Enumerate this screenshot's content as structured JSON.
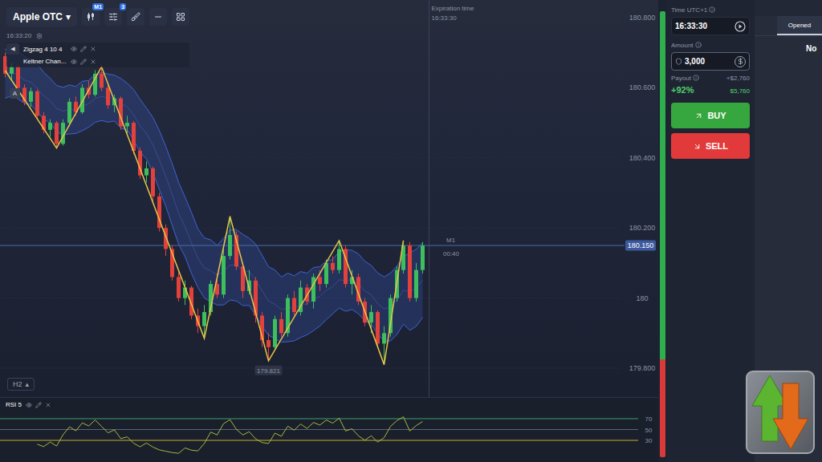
{
  "toolbar": {
    "asset": "Apple OTC",
    "asset_caret": "▾",
    "timeframe_badge": "M1",
    "indicators_badge": "3"
  },
  "chart_clock": "16:33:20",
  "collapse_glyph": "◀",
  "indicators": [
    {
      "label": "Zigzag 4 10 4"
    },
    {
      "label": "Keltner Chan..."
    }
  ],
  "drawing_marker": "A",
  "expiration": {
    "label": "Expiration time",
    "time": "16:33:30",
    "index": 66
  },
  "price_axis": {
    "ticks": [
      {
        "label": "180.800",
        "value": 180.8
      },
      {
        "label": "180.600",
        "value": 180.6
      },
      {
        "label": "180.400",
        "value": 180.4
      },
      {
        "label": "180.200",
        "value": 180.2
      },
      {
        "label": "180",
        "value": 180.0
      },
      {
        "label": "179.800",
        "value": 179.8
      }
    ]
  },
  "current_price": {
    "label": "180.150",
    "value": 180.15,
    "timeframe": "M1",
    "countdown": "00:40"
  },
  "low_label": {
    "label": "179.821",
    "value": 179.821,
    "index": 41
  },
  "candles": [
    [
      180.69,
      180.7,
      180.63,
      180.64
    ],
    [
      180.64,
      180.67,
      180.62,
      180.66
    ],
    [
      180.66,
      180.665,
      180.59,
      180.6
    ],
    [
      180.6,
      180.61,
      180.55,
      180.56
    ],
    [
      180.56,
      180.6,
      180.545,
      180.59
    ],
    [
      180.59,
      180.595,
      180.51,
      180.52
    ],
    [
      180.52,
      180.53,
      180.47,
      180.48
    ],
    [
      180.48,
      180.51,
      180.46,
      180.5
    ],
    [
      180.5,
      180.505,
      180.428,
      180.44
    ],
    [
      180.44,
      180.51,
      180.435,
      180.5
    ],
    [
      180.5,
      180.57,
      180.49,
      180.56
    ],
    [
      180.56,
      180.575,
      180.52,
      180.53
    ],
    [
      180.53,
      180.61,
      180.525,
      180.6
    ],
    [
      180.6,
      180.62,
      180.57,
      180.58
    ],
    [
      180.58,
      180.65,
      180.575,
      180.64
    ],
    [
      180.64,
      180.66,
      180.59,
      180.6
    ],
    [
      180.6,
      180.61,
      180.54,
      180.55
    ],
    [
      180.55,
      180.58,
      180.53,
      180.57
    ],
    [
      180.57,
      180.575,
      180.48,
      180.49
    ],
    [
      180.49,
      180.52,
      180.47,
      180.5
    ],
    [
      180.5,
      180.505,
      180.41,
      180.42
    ],
    [
      180.42,
      180.43,
      180.34,
      180.35
    ],
    [
      180.35,
      180.39,
      180.33,
      180.37
    ],
    [
      180.37,
      180.375,
      180.27,
      180.29
    ],
    [
      180.29,
      180.3,
      180.19,
      180.2
    ],
    [
      180.2,
      180.21,
      180.12,
      180.14
    ],
    [
      180.14,
      180.15,
      180.05,
      180.06
    ],
    [
      180.06,
      180.08,
      179.99,
      180.0
    ],
    [
      180.0,
      180.05,
      179.98,
      180.03
    ],
    [
      180.03,
      180.035,
      179.94,
      179.95
    ],
    [
      179.95,
      179.97,
      179.9,
      179.92
    ],
    [
      179.92,
      179.98,
      179.885,
      179.96
    ],
    [
      179.96,
      180.05,
      179.95,
      180.04
    ],
    [
      180.04,
      180.07,
      180.0,
      180.01
    ],
    [
      180.01,
      180.14,
      180.0,
      180.12
    ],
    [
      180.12,
      180.233,
      180.11,
      180.18
    ],
    [
      180.18,
      180.19,
      180.08,
      180.09
    ],
    [
      180.09,
      180.1,
      180.0,
      180.02
    ],
    [
      180.02,
      180.08,
      180.01,
      180.05
    ],
    [
      180.05,
      180.06,
      179.93,
      179.95
    ],
    [
      179.95,
      179.96,
      179.86,
      179.88
    ],
    [
      179.88,
      179.9,
      179.821,
      179.86
    ],
    [
      179.86,
      179.95,
      179.85,
      179.94
    ],
    [
      179.94,
      179.96,
      179.89,
      179.9
    ],
    [
      179.9,
      180.01,
      179.89,
      180.0
    ],
    [
      180.0,
      180.02,
      179.95,
      179.96
    ],
    [
      179.96,
      180.05,
      179.95,
      180.03
    ],
    [
      180.03,
      180.04,
      179.98,
      179.99
    ],
    [
      179.99,
      180.07,
      179.97,
      180.06
    ],
    [
      180.06,
      180.08,
      180.02,
      180.04
    ],
    [
      180.04,
      180.11,
      180.03,
      180.1
    ],
    [
      180.1,
      180.12,
      180.07,
      180.08
    ],
    [
      180.08,
      180.164,
      180.07,
      180.14
    ],
    [
      180.14,
      180.15,
      180.03,
      180.04
    ],
    [
      180.04,
      180.08,
      180.01,
      180.06
    ],
    [
      180.06,
      180.07,
      179.98,
      179.99
    ],
    [
      179.99,
      180.0,
      179.92,
      179.93
    ],
    [
      179.93,
      179.98,
      179.9,
      179.96
    ],
    [
      179.96,
      179.965,
      179.86,
      179.87
    ],
    [
      179.87,
      179.92,
      179.81,
      179.9
    ],
    [
      179.9,
      180.01,
      179.89,
      180.0
    ],
    [
      180.0,
      180.09,
      179.99,
      180.08
    ],
    [
      180.08,
      180.164,
      180.07,
      180.15
    ],
    [
      180.15,
      180.16,
      179.99,
      180.0
    ],
    [
      180.0,
      180.1,
      179.99,
      180.08
    ],
    [
      180.08,
      180.16,
      180.07,
      180.15
    ]
  ],
  "zigzag": [
    [
      0,
      180.649
    ],
    [
      8,
      180.428
    ],
    [
      15,
      180.66
    ],
    [
      31,
      179.885
    ],
    [
      35,
      180.233
    ],
    [
      41,
      179.821
    ],
    [
      52,
      180.164
    ],
    [
      59,
      179.81
    ],
    [
      62,
      180.164
    ]
  ],
  "period_badge": {
    "label": "H2",
    "caret": "▴"
  },
  "rsi": {
    "label": "RSI 5",
    "levels": [
      {
        "label": "70",
        "value": 70
      },
      {
        "label": "50",
        "value": 50
      },
      {
        "label": "30",
        "value": 30
      }
    ]
  },
  "sentiment": {
    "up_level": 0.78
  },
  "trade": {
    "time_label": "Time UTC+1",
    "time": "16:33:30",
    "amount_label": "Amount",
    "amount": "3,000",
    "amount_focused": true,
    "payout_label": "Payout",
    "profit": "+$2,760",
    "payout_percent": "+92%",
    "payout_total": "$5,760",
    "buy": "BUY",
    "sell": "SELL"
  },
  "orders": {
    "tabs": [
      {
        "label": "Opened",
        "selected": true
      }
    ],
    "empty_text": "No"
  }
}
